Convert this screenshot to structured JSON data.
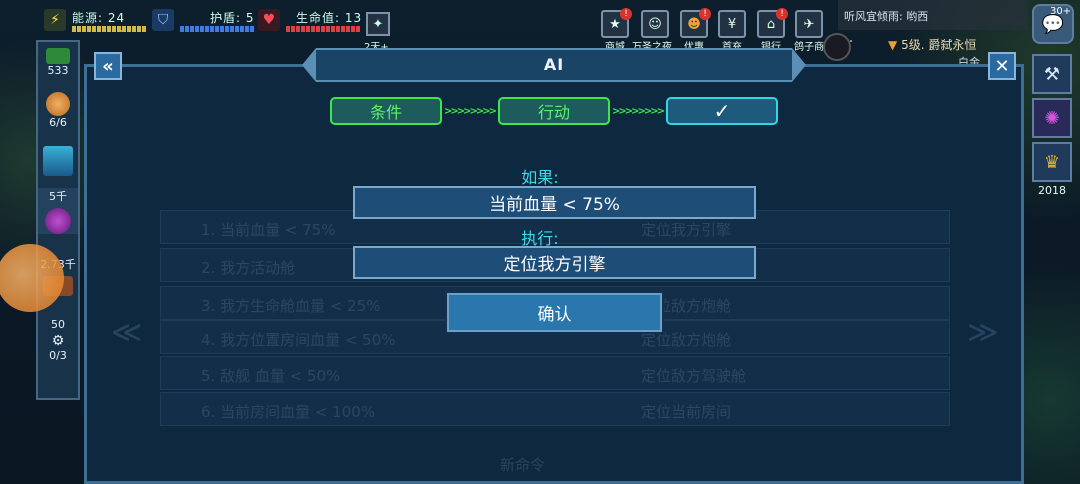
{
  "hud": {
    "energy": {
      "label": "能源: 24"
    },
    "shield": {
      "label": "护盾: 5"
    },
    "hull": {
      "label": "生命值: 13"
    },
    "sector_hint": "2天+",
    "notice": "听风宜倾雨: 哟西",
    "level_text": "5级. 爵弑永恒",
    "level_sub": "白金",
    "top_right_count": "30+"
  },
  "nav": [
    {
      "label": "商城",
      "icon": "star-icon",
      "badge": "!"
    },
    {
      "label": "万圣之夜",
      "icon": "pumpkin-icon",
      "badge": ""
    },
    {
      "label": "优惠",
      "icon": "gift-icon",
      "badge": "!"
    },
    {
      "label": "首充",
      "icon": "yen-icon",
      "badge": ""
    },
    {
      "label": "银行",
      "icon": "bank-icon",
      "badge": "!"
    },
    {
      "label": "鸽子商",
      "icon": "dove-icon",
      "badge": ""
    }
  ],
  "left_panel": {
    "scrap": "533",
    "crew": "6/6",
    "resource_a": "5千",
    "resource_b": "2.73千",
    "cargo": "50",
    "stations": "0/3"
  },
  "right_panel": {
    "trophy_count": "2018"
  },
  "modal": {
    "title": "AI",
    "steps": [
      "条件",
      "行动",
      "✓"
    ],
    "if_label": "如果:",
    "condition_value": "当前血量 < 75%",
    "then_label": "执行:",
    "action_value": "定位我方引擎",
    "confirm_label": "确认"
  },
  "background_rules": [
    {
      "condition": "1. 当前血量 < 75%",
      "action": "定位我方引擎"
    },
    {
      "condition": "2. 我方活动舱",
      "action": ""
    },
    {
      "condition": "3. 我方生命舱血量 < 25%",
      "action": "定位敌方炮舱"
    },
    {
      "condition": "4. 我方位置房间血量 < 50%",
      "action": "定位敌方炮舱"
    },
    {
      "condition": "5. 敌舰 血量 < 50%",
      "action": "定位敌方驾驶舱"
    },
    {
      "condition": "6. 当前房间血量 < 100%",
      "action": "定位当前房间"
    }
  ],
  "new_command_label": "新命令"
}
